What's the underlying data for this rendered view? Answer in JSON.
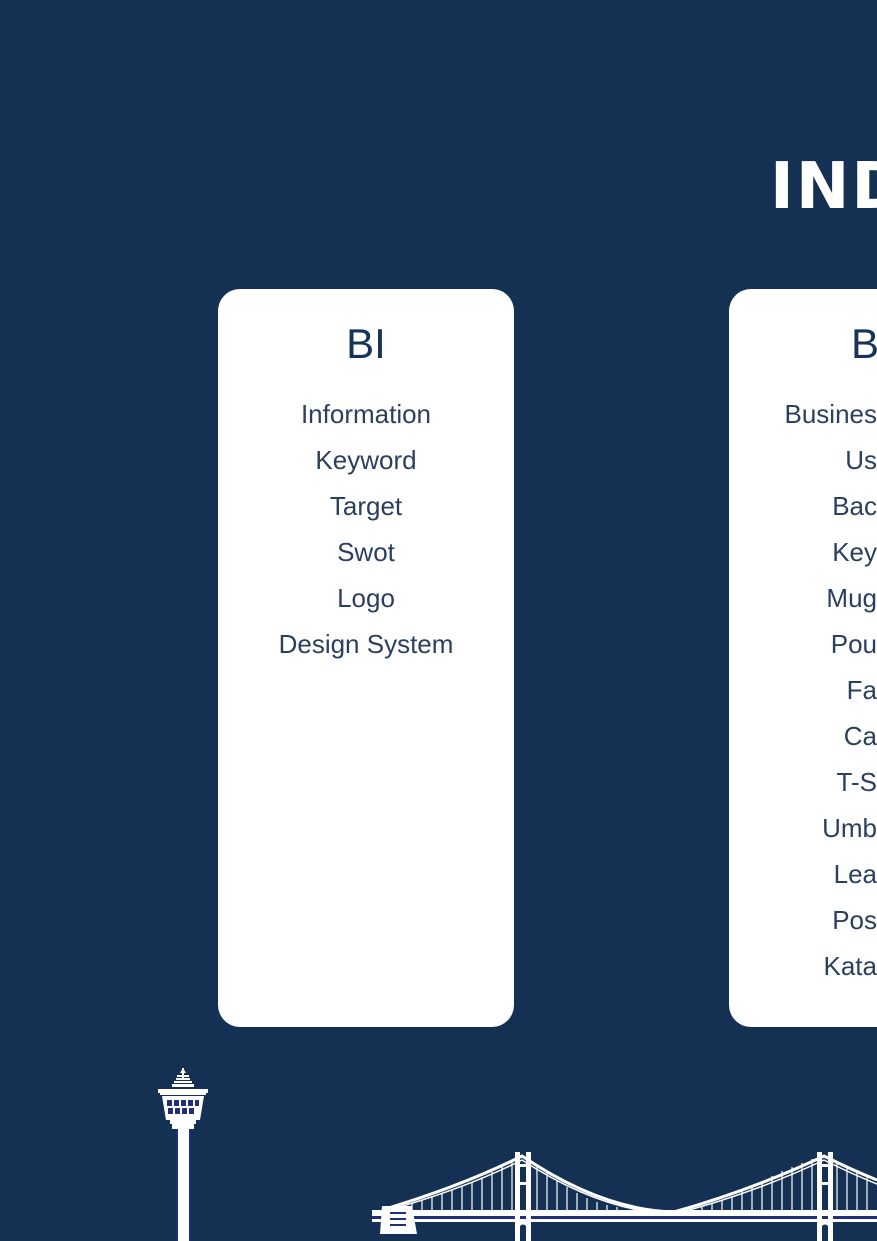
{
  "page": {
    "title": "IND"
  },
  "cards": [
    {
      "heading": "BI",
      "items": [
        "Information",
        "Keyword",
        "Target",
        "Swot",
        "Logo",
        "Design System"
      ]
    },
    {
      "heading": "B",
      "items": [
        "Busines",
        "Us",
        "Bac",
        "Key",
        "Mug",
        "Pou",
        "Fa",
        "Ca",
        "T-S",
        "Umb",
        "Lea",
        "Pos",
        "Kata"
      ]
    }
  ],
  "colors": {
    "background": "#143052",
    "card": "#ffffff",
    "text": "#2c3f5f"
  },
  "illustrations": [
    "tower-illustration",
    "bridge-illustration"
  ]
}
